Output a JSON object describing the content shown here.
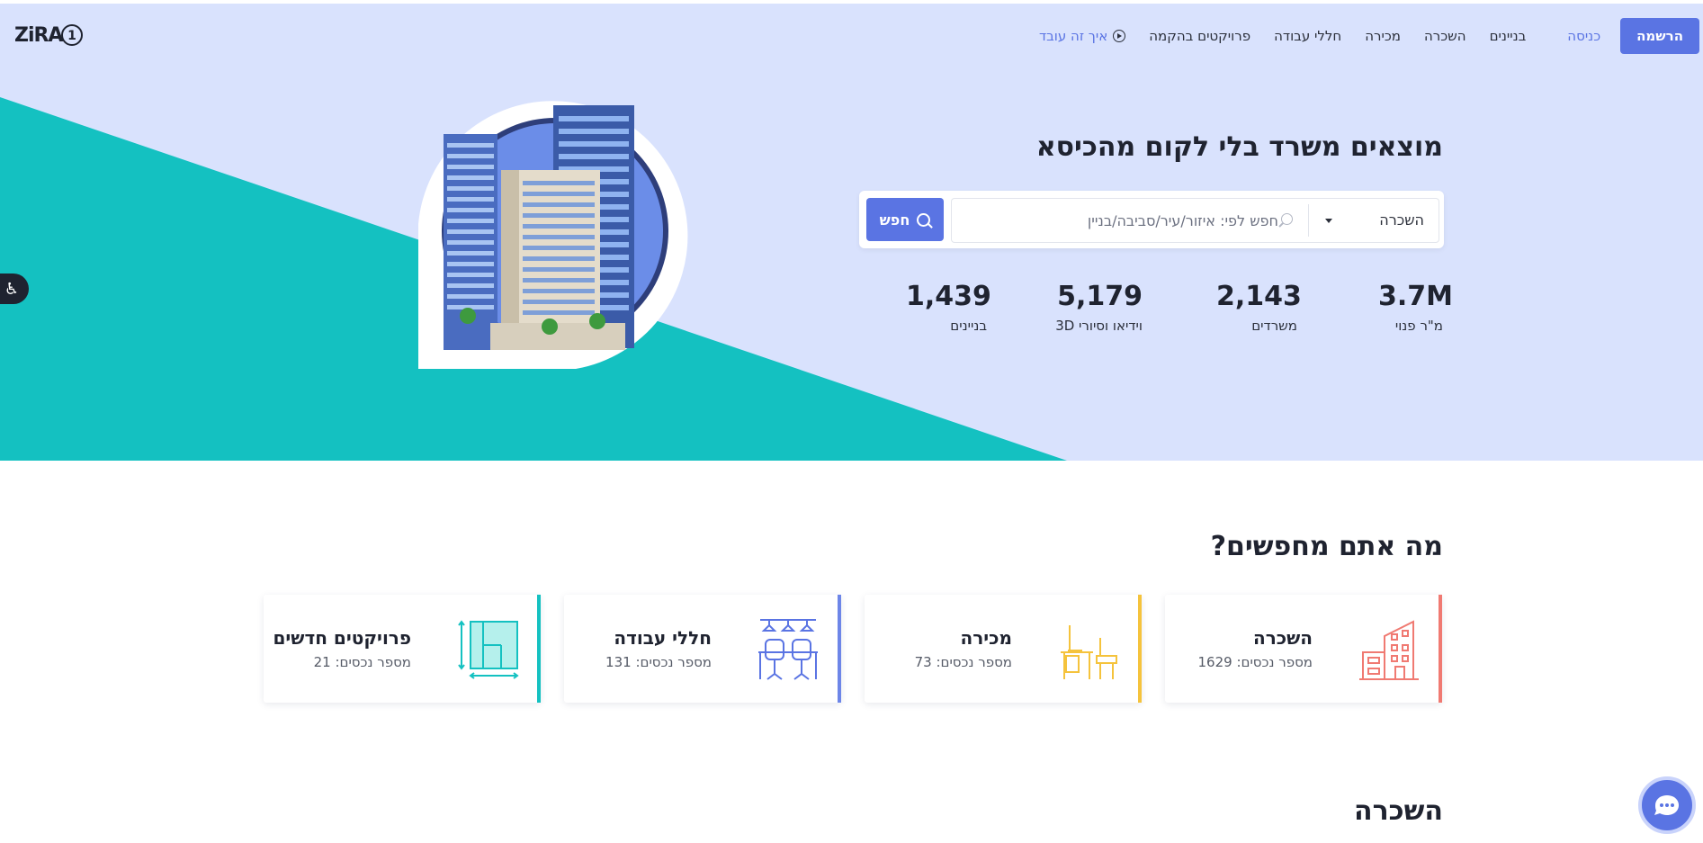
{
  "header": {
    "logo_text": "ZiRA",
    "logo_number": "1",
    "register_label": "הרשמה",
    "login_label": "כניסה",
    "nav": [
      "בניינים",
      "השכרה",
      "מכירה",
      "חללי עבודה",
      "פרויקטים בהקמה"
    ],
    "how_it_works": "איך זה עובד"
  },
  "hero": {
    "title": "מוצאים משרד בלי לקום מהכיסא",
    "deal_type": "השכרה",
    "search_placeholder": "חפש לפי: איזור/עיר/סביבה/בניין",
    "search_button": "חפש",
    "stats": [
      {
        "value": "3.7M",
        "label": "מ\"ר פנוי"
      },
      {
        "value": "2,143",
        "label": "משרדים"
      },
      {
        "value": "5,179",
        "label": "וידיאו וסיורי 3D"
      },
      {
        "value": "1,439",
        "label": "בניינים"
      }
    ]
  },
  "colors": {
    "accent": "#5a74e3",
    "hero_bg": "#d9e2fd",
    "teal": "#14c1c1",
    "rent": "#f07a72",
    "sale": "#f5c33c",
    "workspaces": "#6d86e8",
    "projects": "#14c1c1"
  },
  "categories": {
    "title": "מה אתם מחפשים?",
    "items": [
      {
        "title": "השכרה",
        "sub": "מספר נכסים: 1629",
        "icon": "buildings-icon"
      },
      {
        "title": "מכירה",
        "sub": "מספר נכסים: 73",
        "icon": "office-desk-icon"
      },
      {
        "title": "חללי עבודה",
        "sub": "מספר נכסים: 131",
        "icon": "coworking-icon"
      },
      {
        "title": "פרויקטים חדשים",
        "sub": "מספר נכסים: 21",
        "icon": "floor-plan-icon"
      }
    ]
  },
  "rent_section": {
    "title": "השכרה"
  }
}
